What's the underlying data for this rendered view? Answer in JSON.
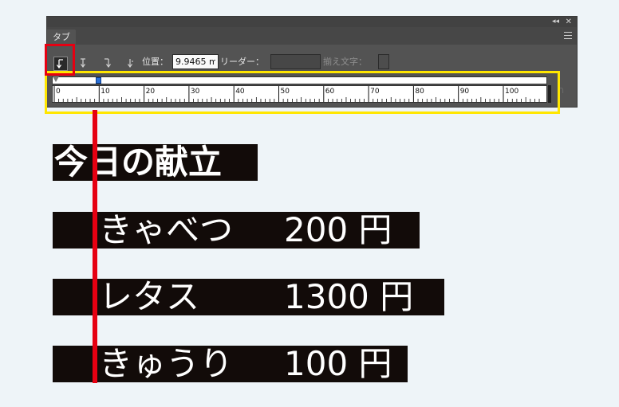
{
  "panel": {
    "tab_label": "タブ",
    "collapse_glyph": "◂◂",
    "close_glyph": "✕",
    "position_label": "位置：",
    "position_value": "9.9465 m",
    "leader_label": "リーダー：",
    "leader_value": "",
    "align_char_label": "揃え文字：",
    "align_char_value": "",
    "align_buttons": [
      {
        "name": "left-justified-tab",
        "selected": true
      },
      {
        "name": "center-justified-tab",
        "selected": false
      },
      {
        "name": "right-justified-tab",
        "selected": false
      },
      {
        "name": "decimal-justified-tab",
        "selected": false
      }
    ]
  },
  "ruler": {
    "tick_labels": [
      "0",
      "10",
      "20",
      "30",
      "40",
      "50",
      "60",
      "70",
      "80",
      "90",
      "100"
    ],
    "tab_stop_value": 9.9465
  },
  "document": {
    "title": "今日の献立",
    "rows": [
      {
        "name": "きゃべつ",
        "price": "200 円"
      },
      {
        "name": "レタス",
        "price": "1300 円"
      },
      {
        "name": "きゅうり",
        "price": "100 円"
      }
    ]
  },
  "colors": {
    "highlight_red": "#e60012",
    "highlight_yellow": "#ffe600",
    "text_background": "#120b09",
    "panel": "#535353",
    "page": "#eef4f8"
  }
}
